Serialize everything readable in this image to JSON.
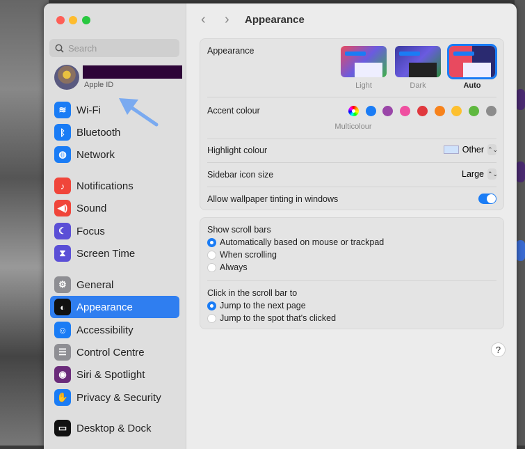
{
  "sidebar": {
    "search_placeholder": "Search",
    "account_label": "Apple ID",
    "items": [
      {
        "label": "Wi-Fi",
        "icon": "wifi-icon",
        "color": "#1a7cf5"
      },
      {
        "label": "Bluetooth",
        "icon": "bluetooth-icon",
        "color": "#1a7cf5"
      },
      {
        "label": "Network",
        "icon": "globe-icon",
        "color": "#1a7cf5"
      },
      {
        "label": "Notifications",
        "icon": "bell-icon",
        "color": "#f0453a"
      },
      {
        "label": "Sound",
        "icon": "speaker-icon",
        "color": "#f0453a"
      },
      {
        "label": "Focus",
        "icon": "moon-icon",
        "color": "#5b4fd6"
      },
      {
        "label": "Screen Time",
        "icon": "hourglass-icon",
        "color": "#5b4fd6"
      },
      {
        "label": "General",
        "icon": "gear-icon",
        "color": "#8e8e93"
      },
      {
        "label": "Appearance",
        "icon": "appearance-icon",
        "color": "#111111",
        "selected": true
      },
      {
        "label": "Accessibility",
        "icon": "accessibility-icon",
        "color": "#1a7cf5"
      },
      {
        "label": "Control Centre",
        "icon": "toggles-icon",
        "color": "#8e8e93"
      },
      {
        "label": "Siri & Spotlight",
        "icon": "siri-icon",
        "color": "#6a2b7a"
      },
      {
        "label": "Privacy & Security",
        "icon": "hand-icon",
        "color": "#1a7cf5"
      },
      {
        "label": "Desktop & Dock",
        "icon": "dock-icon",
        "color": "#111111"
      }
    ]
  },
  "header": {
    "title": "Appearance"
  },
  "appearance": {
    "label": "Appearance",
    "options": [
      {
        "label": "Light",
        "selected": false
      },
      {
        "label": "Dark",
        "selected": false
      },
      {
        "label": "Auto",
        "selected": true
      }
    ]
  },
  "accent": {
    "label": "Accent colour",
    "selected_label": "Multicolour",
    "colors": [
      "multicolour",
      "#1a7cf5",
      "#9a46a8",
      "#ef4fa0",
      "#e0383e",
      "#f7821b",
      "#fdc02f",
      "#5fb83f",
      "#8c8c8c"
    ]
  },
  "highlight": {
    "label": "Highlight colour",
    "value": "Other",
    "swatch": "#cfe2fb"
  },
  "sidebar_icon_size": {
    "label": "Sidebar icon size",
    "value": "Large"
  },
  "wallpaper_tinting": {
    "label": "Allow wallpaper tinting in windows",
    "on": true
  },
  "scroll_bars": {
    "label": "Show scroll bars",
    "options": [
      "Automatically based on mouse or trackpad",
      "When scrolling",
      "Always"
    ],
    "selected": 0
  },
  "click_scroll": {
    "label": "Click in the scroll bar to",
    "options": [
      "Jump to the next page",
      "Jump to the spot that's clicked"
    ],
    "selected": 0
  },
  "help_label": "?"
}
